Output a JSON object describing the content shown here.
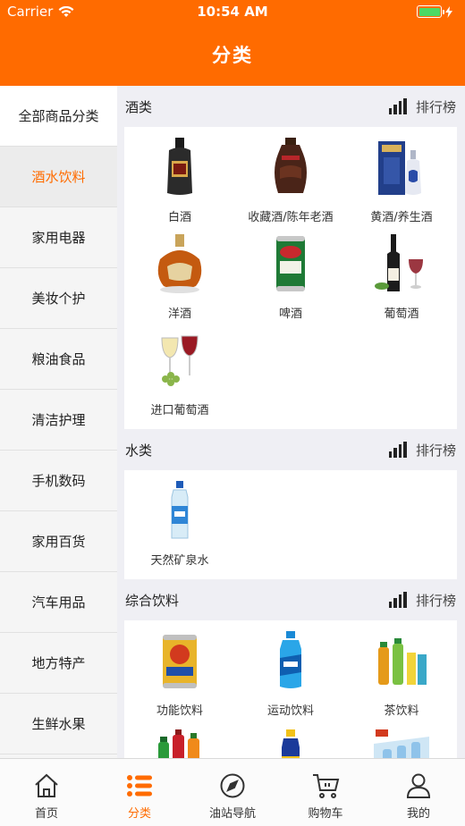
{
  "status_bar": {
    "carrier": "Carrier",
    "time": "10:54 AM",
    "battery_level": 1.0
  },
  "nav": {
    "title": "分类"
  },
  "sidebar": {
    "items": [
      {
        "label": "全部商品分类"
      },
      {
        "label": "酒水饮料"
      },
      {
        "label": "家用电器"
      },
      {
        "label": "美妆个护"
      },
      {
        "label": "粮油食品"
      },
      {
        "label": "清洁护理"
      },
      {
        "label": "手机数码"
      },
      {
        "label": "家用百货"
      },
      {
        "label": "汽车用品"
      },
      {
        "label": "地方特产"
      },
      {
        "label": "生鲜水果"
      }
    ],
    "active_index": 1
  },
  "sections": [
    {
      "title": "酒类",
      "rank_label": "排行榜",
      "items": [
        {
          "label": "白酒",
          "icon": "baijiu-bottle-image"
        },
        {
          "label": "收藏酒/陈年老酒",
          "icon": "aged-liquor-jar-image"
        },
        {
          "label": "黄酒/养生酒",
          "icon": "yellow-wine-box-image"
        },
        {
          "label": "洋酒",
          "icon": "cognac-bottle-image"
        },
        {
          "label": "啤酒",
          "icon": "beer-can-image"
        },
        {
          "label": "葡萄酒",
          "icon": "red-wine-image"
        },
        {
          "label": "进口葡萄酒",
          "icon": "imported-wine-glasses-image"
        }
      ]
    },
    {
      "title": "水类",
      "rank_label": "排行榜",
      "items": [
        {
          "label": "天然矿泉水",
          "icon": "mineral-water-bottle-image"
        }
      ]
    },
    {
      "title": "综合饮料",
      "rank_label": "排行榜",
      "items": [
        {
          "label": "功能饮料",
          "icon": "energy-drink-can-image"
        },
        {
          "label": "运动饮料",
          "icon": "sports-drink-bottle-image"
        },
        {
          "label": "茶饮料",
          "icon": "tea-drink-bottles-image"
        },
        {
          "label": "",
          "icon": "soda-bottles-image"
        },
        {
          "label": "",
          "icon": "blue-bottle-image"
        },
        {
          "label": "",
          "icon": "water-pack-image"
        }
      ]
    }
  ],
  "tabbar": {
    "items": [
      {
        "label": "首页",
        "icon": "home-icon"
      },
      {
        "label": "分类",
        "icon": "list-icon"
      },
      {
        "label": "油站导航",
        "icon": "compass-icon"
      },
      {
        "label": "购物车",
        "icon": "cart-icon"
      },
      {
        "label": "我的",
        "icon": "user-icon"
      }
    ],
    "active_index": 1
  },
  "colors": {
    "accent": "#ff6b00",
    "battery": "#4cd964"
  }
}
